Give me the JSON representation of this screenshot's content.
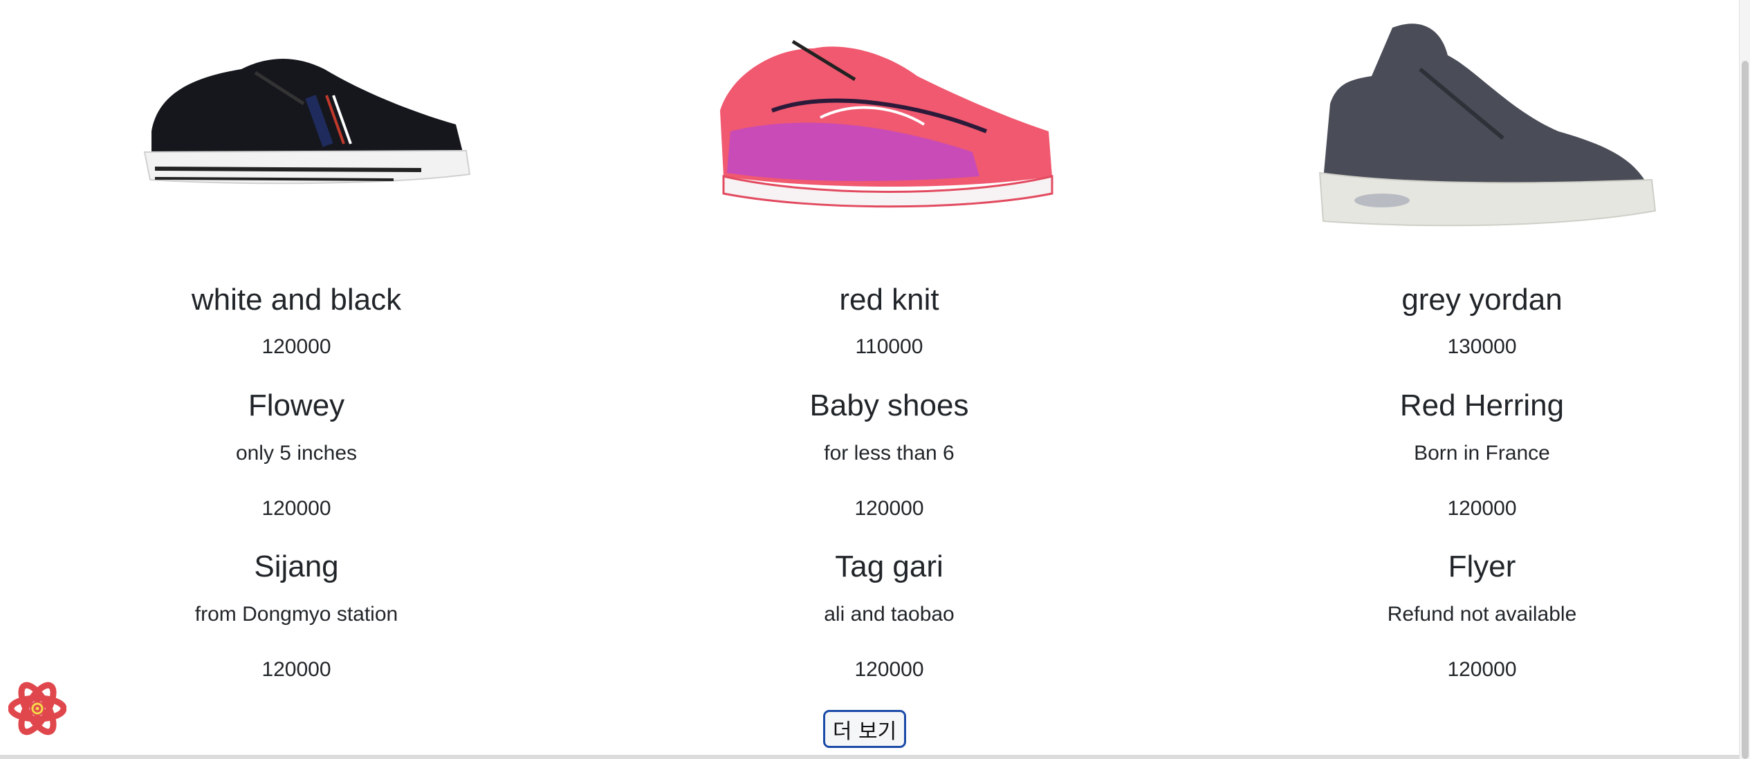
{
  "products": [
    {
      "image_icon": "black-sneaker-image",
      "name": "white and black",
      "price": "120000",
      "items": [
        {
          "title": "Flowey",
          "desc": "only 5 inches",
          "price": "120000"
        },
        {
          "title": "Sijang",
          "desc": "from Dongmyo station",
          "price": "120000"
        }
      ]
    },
    {
      "image_icon": "pink-running-shoe-image",
      "name": "red knit",
      "price": "110000",
      "items": [
        {
          "title": "Baby shoes",
          "desc": "for less than 6",
          "price": "120000"
        },
        {
          "title": "Tag gari",
          "desc": "ali and taobao",
          "price": "120000"
        }
      ]
    },
    {
      "image_icon": "grey-high-top-sneaker-image",
      "name": "grey yordan",
      "price": "130000",
      "items": [
        {
          "title": "Red Herring",
          "desc": "Born in France",
          "price": "120000"
        },
        {
          "title": "Flyer",
          "desc": "Refund not available",
          "price": "120000"
        }
      ]
    }
  ],
  "more_button_label": "더 보기",
  "devtools_icon": "react-atom-icon",
  "colors": {
    "text": "#212529",
    "button_border": "#1a4aa8",
    "react_icon": "#e0474c"
  }
}
